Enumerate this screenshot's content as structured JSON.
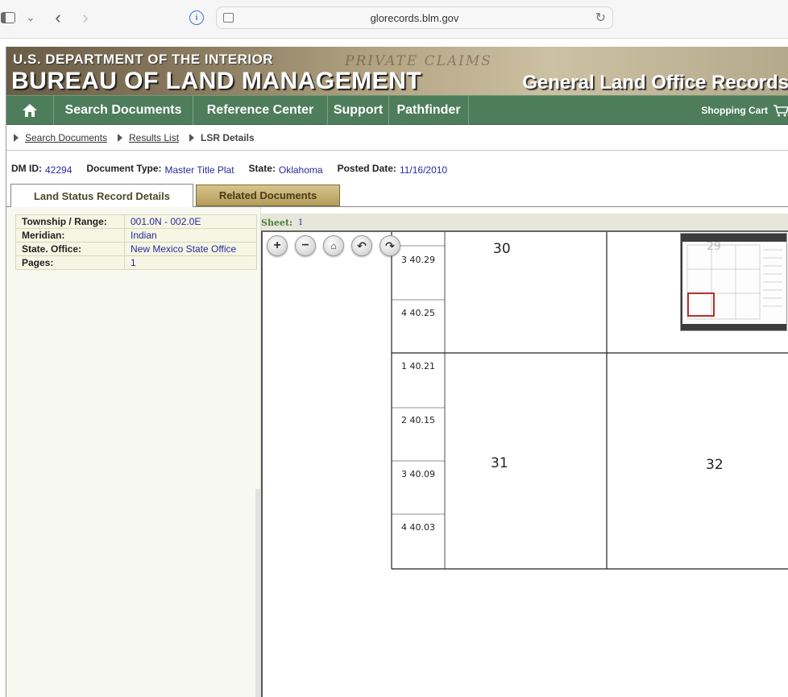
{
  "browser": {
    "url": "glorecords.blm.gov"
  },
  "banner": {
    "department": "U.S. DEPARTMENT OF THE INTERIOR",
    "bureau": "BUREAU OF LAND MANAGEMENT",
    "site_title": "General Land Office Records",
    "watermark": "PRIVATE CLAIMS"
  },
  "nav": {
    "items": [
      "Search Documents",
      "Reference Center",
      "Support",
      "Pathfinder"
    ],
    "cart": "Shopping Cart"
  },
  "breadcrumb": [
    "Search Documents",
    "Results List",
    "LSR Details"
  ],
  "meta": {
    "dm_id_label": "DM ID:",
    "dm_id": "42294",
    "doc_type_label": "Document Type:",
    "doc_type": "Master Title Plat",
    "state_label": "State:",
    "state": "Oklahoma",
    "posted_label": "Posted Date:",
    "posted": "11/16/2010"
  },
  "tabs": [
    "Land Status Record Details",
    "Related Documents"
  ],
  "details": [
    {
      "label": "Township / Range:",
      "value": "001.0N - 002.0E"
    },
    {
      "label": "Meridian:",
      "value": "Indian"
    },
    {
      "label": "State. Office:",
      "value": "New Mexico State Office"
    },
    {
      "label": "Pages:",
      "value": "1"
    }
  ],
  "sheet": {
    "label": "Sheet:",
    "value": "1"
  },
  "plat": {
    "sections": [
      "30",
      "31",
      "32",
      "29"
    ],
    "lots": [
      "3 40.29",
      "4 40.25",
      "1 40.21",
      "2 40.15",
      "3 40.09",
      "4 40.03"
    ]
  },
  "viewer_controls": [
    "zoom-in",
    "zoom-out",
    "home",
    "rotate-left",
    "rotate-right"
  ]
}
